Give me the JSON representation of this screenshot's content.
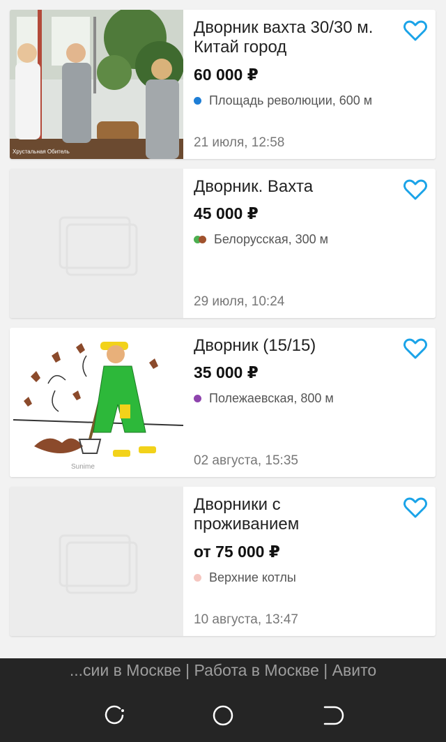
{
  "listings": [
    {
      "title": "Дворник вахта 30/30 м. Китай город",
      "price": "60 000 ₽",
      "metro": "Площадь революции, 600 м",
      "metro_colors": [
        "#1e7ed6"
      ],
      "date": "21 июля, 12:58",
      "image": "photo"
    },
    {
      "title": "Дворник. Вахта",
      "price": "45 000 ₽",
      "metro": "Белорусская, 300 м",
      "metro_colors": [
        "#4caf50",
        "#a0522d"
      ],
      "date": "29 июля, 10:24",
      "image": "placeholder"
    },
    {
      "title": "Дворник (15/15)",
      "price": "35 000 ₽",
      "metro": "Полежаевская, 800 м",
      "metro_colors": [
        "#8e44ad"
      ],
      "date": "02 августа, 15:35",
      "image": "illustration"
    },
    {
      "title": "Дворники с проживанием",
      "price": "от 75 000 ₽",
      "metro": "Верхние котлы",
      "metro_colors": [
        "#f5c6c0"
      ],
      "date": "10 августа, 13:47",
      "image": "placeholder"
    }
  ],
  "colors": {
    "favorite": "#1aa3e8"
  },
  "image_watermarks": {
    "photo": "Хрустальная Обитель",
    "illustration": "Sunime"
  },
  "bottom_bar": {
    "page_title": "...сии в Москве | Работа в Москве | Авито"
  },
  "nav_icons": [
    "recent-apps-icon",
    "home-icon",
    "back-icon"
  ]
}
